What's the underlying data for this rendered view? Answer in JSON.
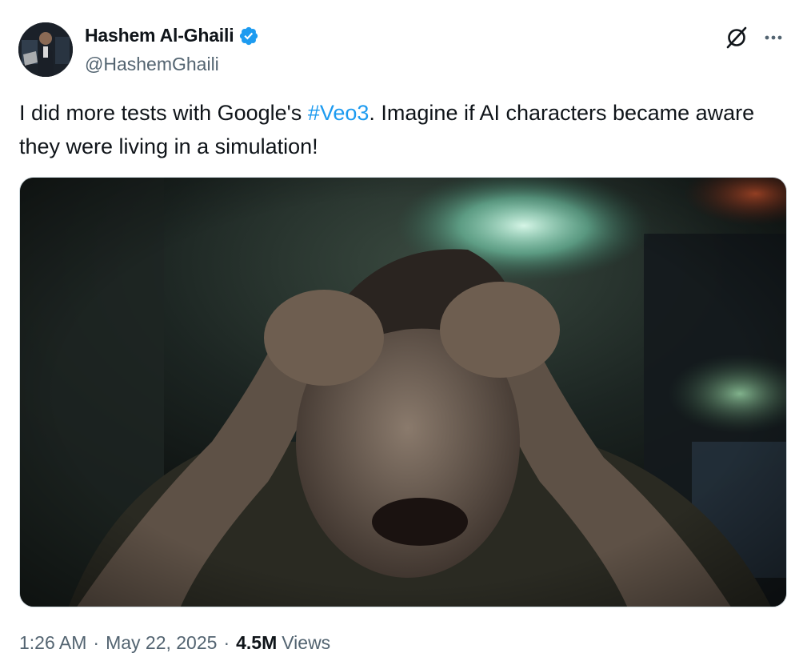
{
  "tweet": {
    "author": {
      "display_name": "Hashem Al-Ghaili",
      "handle": "@HashemGhaili",
      "verified": true,
      "verified_color": "#1d9bf0"
    },
    "text_before": "I did more tests with Google's ",
    "hashtag": "#Veo3",
    "text_after": ". Imagine if AI characters became aware they were living in a simulation!",
    "media": {
      "type": "video-still",
      "description_icon": "video-media"
    },
    "time": "1:26 AM",
    "separator": "·",
    "date": "May 22, 2025",
    "views_count": "4.5M",
    "views_label": "Views"
  },
  "icons": {
    "grok": "grok-icon",
    "more": "more-icon",
    "verified": "verified-badge-icon"
  },
  "colors": {
    "text_primary": "#0f1419",
    "text_secondary": "#536471",
    "link": "#1d9bf0",
    "border": "#cfd9de"
  }
}
